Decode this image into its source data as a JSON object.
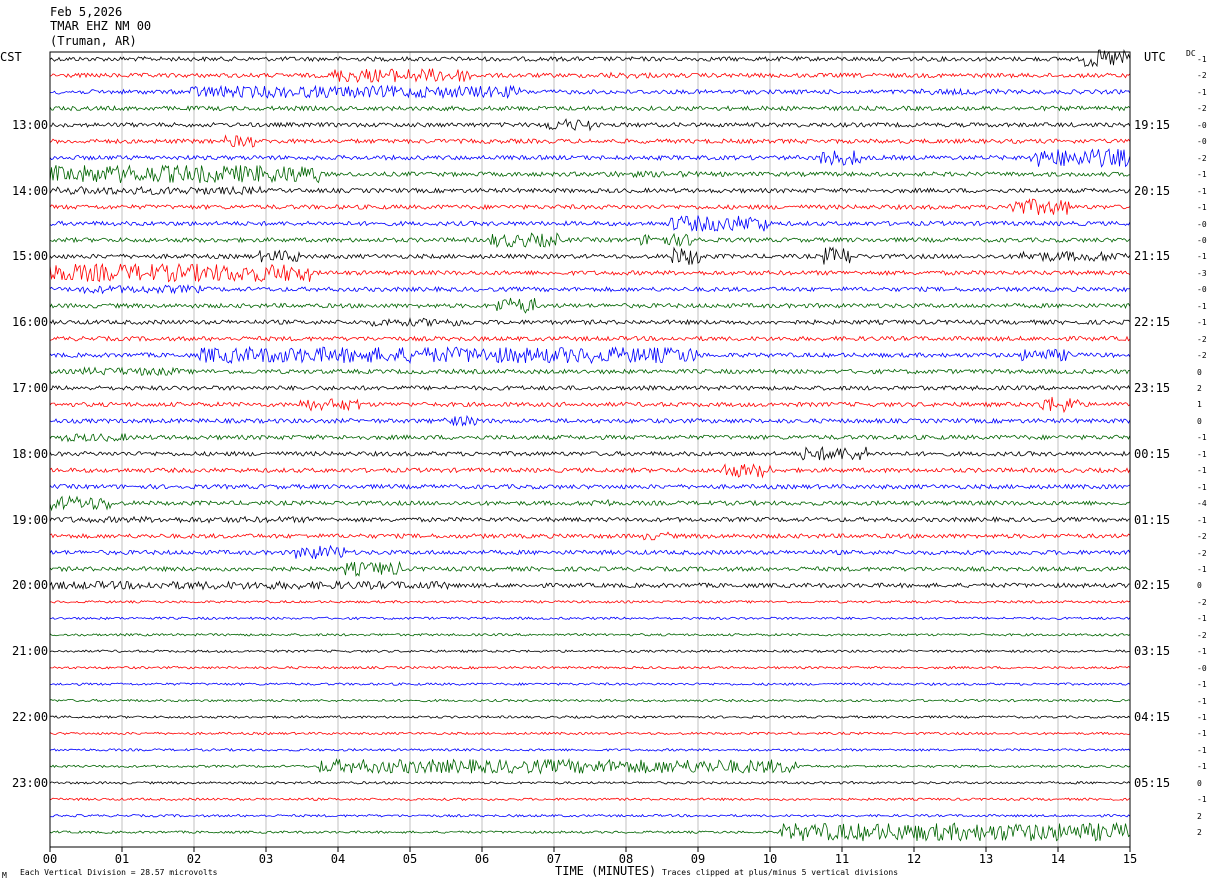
{
  "header": {
    "date": "Feb 5,2026",
    "channel": "TMAR EHZ NM 00",
    "location": "(Truman, AR)"
  },
  "labels": {
    "left_tz": "CST",
    "right_tz": "UTC",
    "dc": "DC",
    "corner": "M"
  },
  "footer": {
    "scale": "Each Vertical Division =   28.57 microvolts",
    "xlabel": "TIME (MINUTES)",
    "clip_note": "Traces clipped at plus/minus 5 vertical divisions"
  },
  "chart_data": {
    "type": "line",
    "title": "Feb 5,2026 TMAR EHZ NM 00 (Truman, AR)",
    "xlabel": "TIME (MINUTES)",
    "xlim": [
      0,
      15
    ],
    "x_ticks": [
      "00",
      "01",
      "02",
      "03",
      "04",
      "05",
      "06",
      "07",
      "08",
      "09",
      "10",
      "11",
      "12",
      "13",
      "14",
      "15"
    ],
    "grid": true,
    "trace_colors": [
      "#000000",
      "#ff0000",
      "#0000ff",
      "#006400"
    ],
    "trace_count": 48,
    "left_hour_labels": [
      "13:00",
      "14:00",
      "15:00",
      "16:00",
      "17:00",
      "18:00",
      "19:00",
      "20:00",
      "21:00",
      "22:00",
      "23:00"
    ],
    "right_hour_labels": [
      "19:15",
      "20:15",
      "21:15",
      "22:15",
      "23:15",
      "00:15",
      "01:15",
      "02:15",
      "03:15",
      "04:15",
      "05:15"
    ],
    "dc_offsets": [
      "-1",
      "-2",
      "-1",
      "-2",
      "-0",
      "-0",
      "-2",
      "-1",
      "-1",
      "-1",
      "-0",
      "-0",
      "-1",
      "-3",
      "-0",
      "-1",
      "-1",
      "-2",
      "-2",
      "0",
      "2",
      "1",
      "0",
      "-1",
      "-1",
      "-1",
      "-1",
      "-4",
      "-1",
      "-2",
      "-2",
      "-1",
      "0",
      "-2",
      "-1",
      "-2",
      "-1",
      "-0",
      "-1",
      "-1",
      "-1",
      "-1",
      "-1",
      "-1",
      "0",
      "-1",
      "2",
      "2"
    ]
  }
}
